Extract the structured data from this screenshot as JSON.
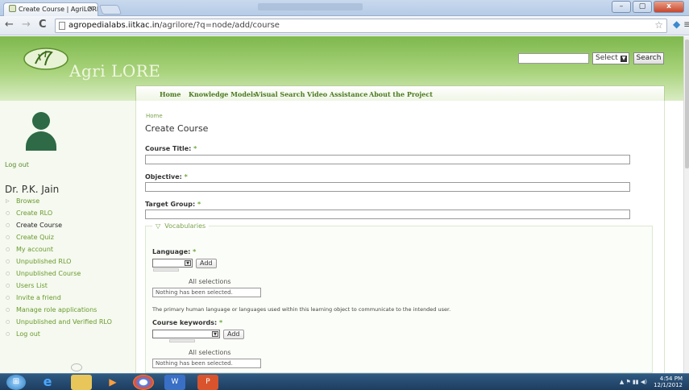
{
  "browser": {
    "tab_title": "Create Course | AgriLORE",
    "tab_close": "×",
    "url_domain": "agropedialabs.iitkac.in",
    "url_path": "/agrilore/?q=node/add/course",
    "nav_back": "←",
    "nav_forward": "→",
    "nav_reload": "C",
    "window_controls": [
      "–",
      "▢",
      "x"
    ]
  },
  "site": {
    "logo_text": "Agri LORE",
    "search": {
      "select_label": "Select",
      "button_label": "Search"
    },
    "nav": [
      "Home",
      "Knowledge Models",
      "Visual Search",
      "Video Assistance",
      "About the Project"
    ]
  },
  "sidebar": {
    "logout_top": "Log out",
    "user_name": "Dr. P.K. Jain",
    "items": [
      "Browse",
      "Create RLO",
      "Create Course",
      "Create Quiz",
      "My account",
      "Unpublished RLO",
      "Unpublished Course",
      "Users List",
      "Invite a friend",
      "Manage role applications",
      "Unpublished and Verified RLO",
      "Log out"
    ],
    "active_item": "Create Course"
  },
  "form": {
    "breadcrumb": "Home",
    "title": "Create Course",
    "required_mark": "*",
    "course_title_label": "Course Title:",
    "objective_label": "Objective:",
    "target_group_label": "Target Group:",
    "vocabularies_legend": "Vocabularies",
    "legend_toggle": "▽",
    "language_label": "Language:",
    "keywords_label": "Course keywords:",
    "add_label": "Add",
    "all_selections": "All selections",
    "nothing_selected": "Nothing has been selected.",
    "language_description": "The primary human language or languages used within this learning object to communicate to the intended user."
  },
  "taskbar": {
    "time": "4:54 PM",
    "date": "12/1/2012",
    "tray_icons": "▲ ⚑ ▮▮ ◀)"
  }
}
